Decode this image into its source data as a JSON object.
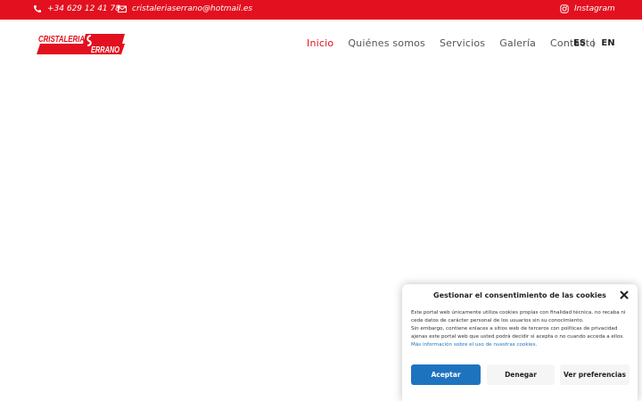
{
  "topbar": {
    "phone": "+34 629 12 41 78",
    "email": "cristaleriaserrano@hotmail.es",
    "social": "Instagram",
    "icons": [
      "phone-icon",
      "envelope-icon",
      "instagram-icon"
    ],
    "bg_color": "#e3101f"
  },
  "header": {
    "logo_text_top": "CRISTALERIA",
    "logo_text_bottom": "ERRANO",
    "nav": [
      {
        "label": "Inicio",
        "active": true
      },
      {
        "label": "Quiénes somos",
        "active": false
      },
      {
        "label": "Servicios",
        "active": false
      },
      {
        "label": "Galería",
        "active": false
      },
      {
        "label": "Contacto",
        "active": false
      }
    ],
    "lang": {
      "es": "ES",
      "sep": "|",
      "en": "EN"
    }
  },
  "consent": {
    "title": "Gestionar el consentimiento de las cookies",
    "line1": "Este portal web únicamente utiliza cookies propias con finalidad técnica, no recaba ni cede datos de carácter personal de los usuarios sin su conocimiento.",
    "line2": "Sin embargo, contiene enlaces a sitios web de terceros con políticas de privacidad ajenas este portal web que usted podrá decidir si acepta o no cuando acceda a ellos.",
    "link": "Más información sobre el uso de nuestras cookies.",
    "accept": "Aceptar",
    "deny": "Denegar",
    "prefs": "Ver preferencias",
    "accent_color": "#1e73be"
  }
}
